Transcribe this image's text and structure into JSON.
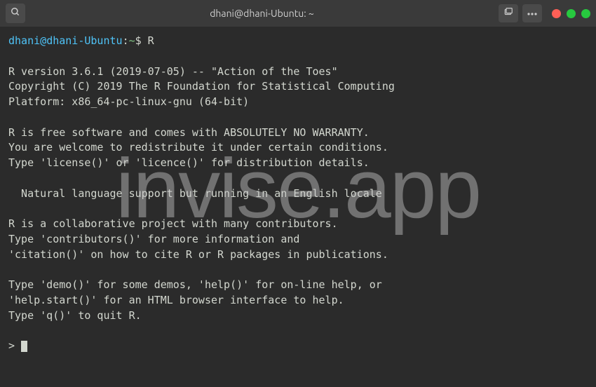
{
  "titlebar": {
    "title": "dhani@dhani-Ubuntu: ~"
  },
  "prompt": {
    "user": "dhani",
    "at": "@",
    "host": "dhani-Ubuntu",
    "colon": ":",
    "path": "~",
    "dollar": "$",
    "command": " R"
  },
  "output": {
    "l1": "",
    "l2": "R version 3.6.1 (2019-07-05) -- \"Action of the Toes\"",
    "l3": "Copyright (C) 2019 The R Foundation for Statistical Computing",
    "l4": "Platform: x86_64-pc-linux-gnu (64-bit)",
    "l5": "",
    "l6": "R is free software and comes with ABSOLUTELY NO WARRANTY.",
    "l7": "You are welcome to redistribute it under certain conditions.",
    "l8": "Type 'license()' or 'licence()' for distribution details.",
    "l9": "",
    "l10": "  Natural language support but running in an English locale",
    "l11": "",
    "l12": "R is a collaborative project with many contributors.",
    "l13": "Type 'contributors()' for more information and",
    "l14": "'citation()' on how to cite R or R packages in publications.",
    "l15": "",
    "l16": "Type 'demo()' for some demos, 'help()' for on-line help, or",
    "l17": "'help.start()' for an HTML browser interface to help.",
    "l18": "Type 'q()' to quit R.",
    "l19": "",
    "l20": "> "
  },
  "watermark": "invise.app"
}
